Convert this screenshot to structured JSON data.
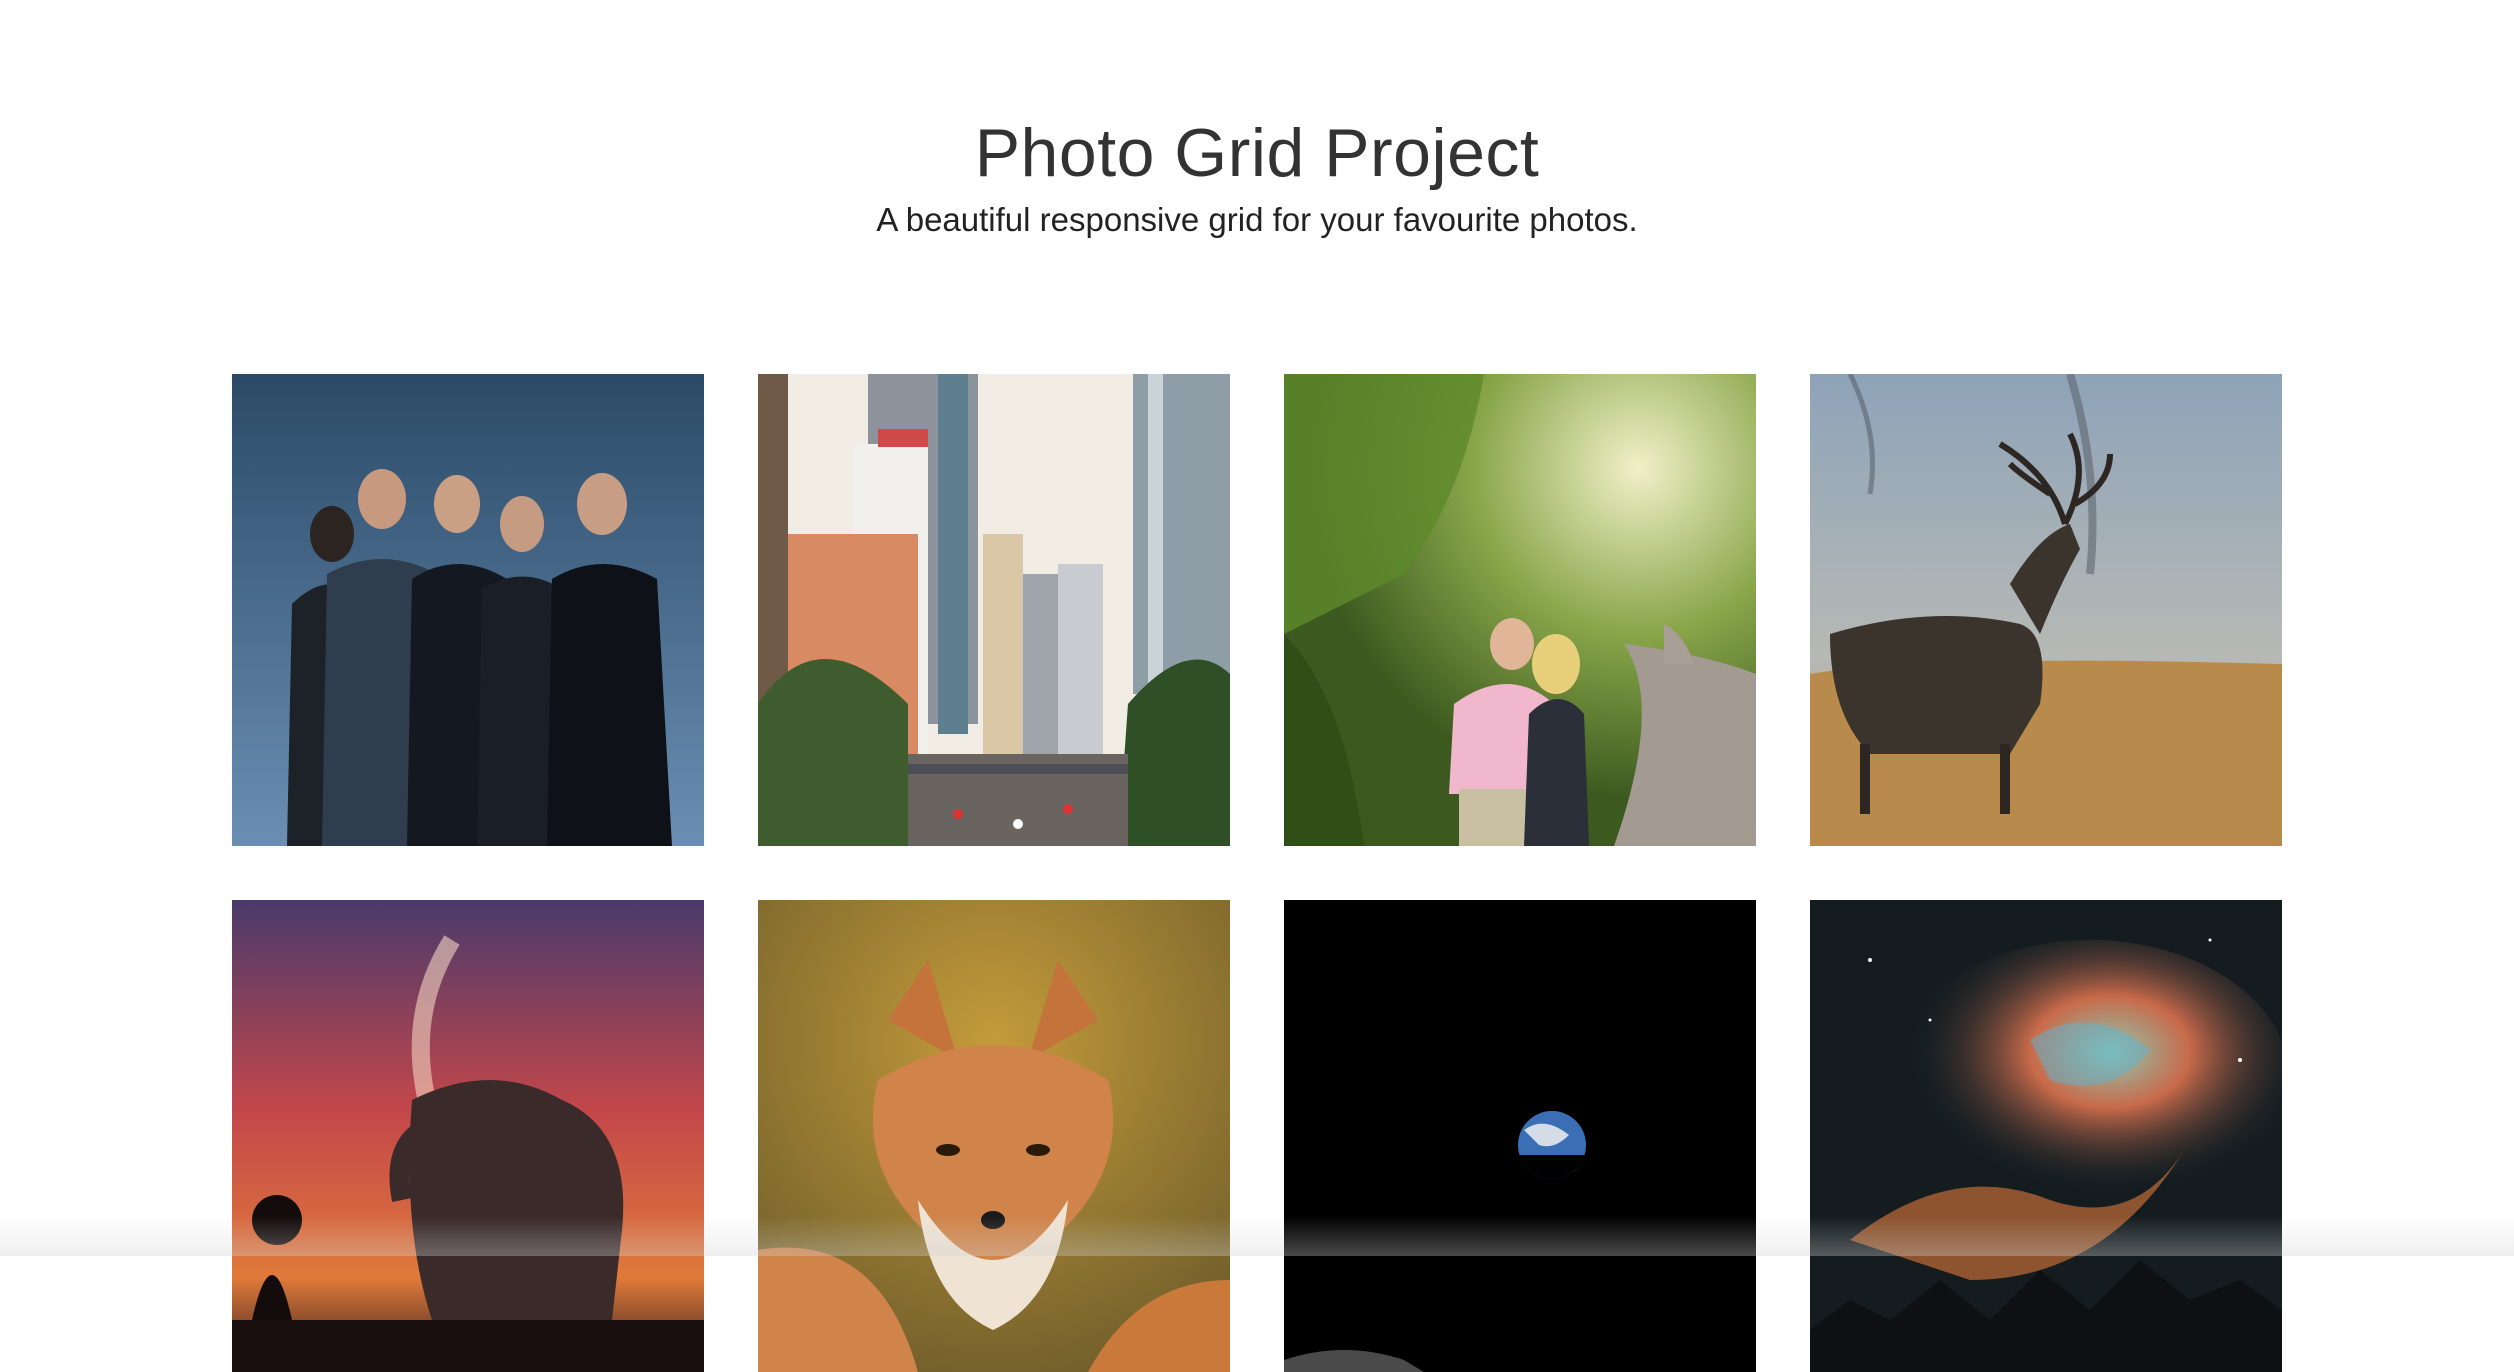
{
  "header": {
    "title": "Photo Grid Project",
    "subtitle": "A beautiful responsive grid for your favourite photos."
  },
  "photos": [
    {
      "subject": "band",
      "accent": "#3f5d7a"
    },
    {
      "subject": "city",
      "accent": "#c9b9a4"
    },
    {
      "subject": "couple-forest",
      "accent": "#6f8f3a"
    },
    {
      "subject": "stag",
      "accent": "#8fa3b6"
    },
    {
      "subject": "elephant-sunset",
      "accent": "#b8403a"
    },
    {
      "subject": "fox",
      "accent": "#c97a3a"
    },
    {
      "subject": "earth-space",
      "accent": "#000000"
    },
    {
      "subject": "nebula",
      "accent": "#1d2a2f"
    }
  ]
}
